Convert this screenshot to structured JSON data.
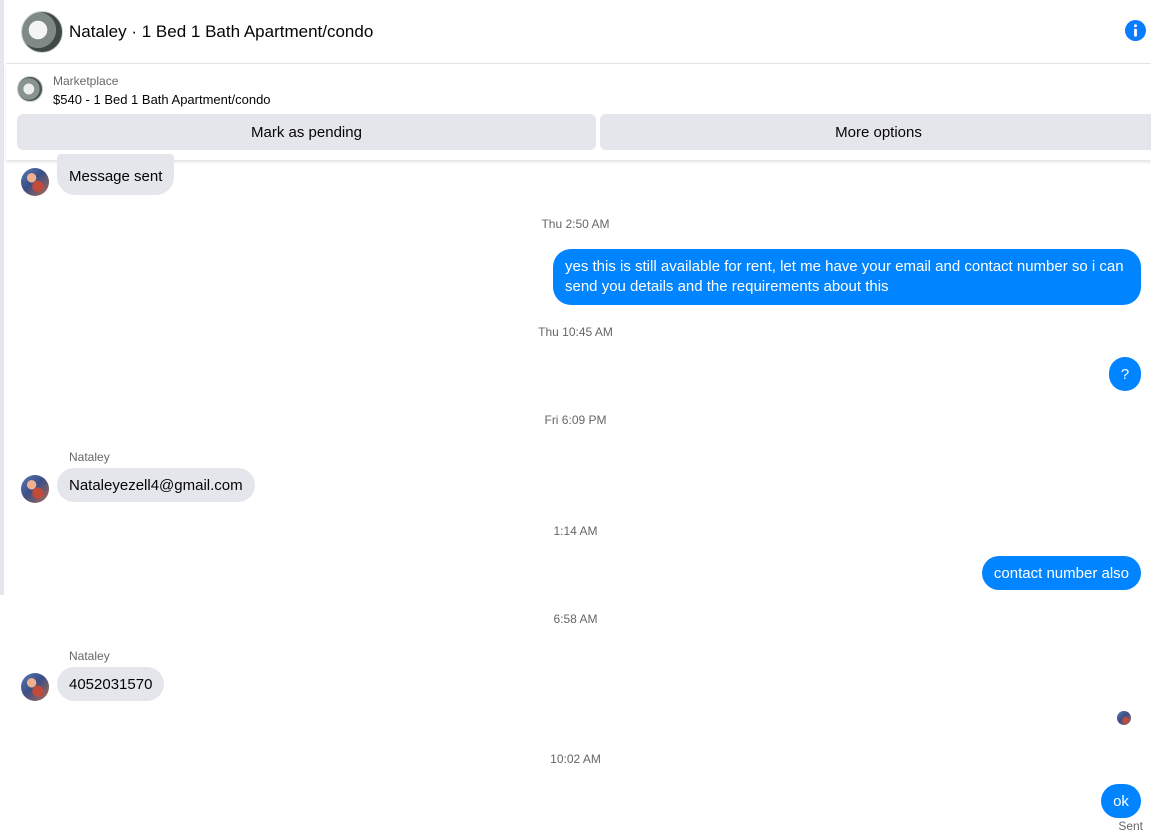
{
  "header": {
    "title": "Nataley · 1 Bed 1 Bath Apartment/condo"
  },
  "listing": {
    "label": "Marketplace",
    "title": "$540 - 1 Bed 1 Bath Apartment/condo",
    "mark_pending_label": "Mark as pending",
    "more_options_label": "More options"
  },
  "messages": {
    "m1": "Message sent",
    "ts1": "Thu 2:50 AM",
    "m2": "yes this is still available for rent, let me have your email  and contact number so i can send you details and the requirements about this",
    "ts2": "Thu 10:45 AM",
    "m3": "?",
    "ts3": "Fri 6:09 PM",
    "sender1": "Nataley",
    "m4": "Nataleyezell4@gmail.com",
    "ts4": "1:14 AM",
    "m5": "contact number also",
    "ts5": "6:58 AM",
    "sender2": "Nataley",
    "m6": "4052031570",
    "ts6": "10:02 AM",
    "m7": "ok",
    "status": "Sent"
  },
  "colors": {
    "outgoing_bubble": "#0084ff",
    "incoming_bubble": "#e4e6eb",
    "button_bg": "#e4e6eb",
    "info_icon": "#0a7cff"
  },
  "icons": {
    "info": "info-icon"
  }
}
